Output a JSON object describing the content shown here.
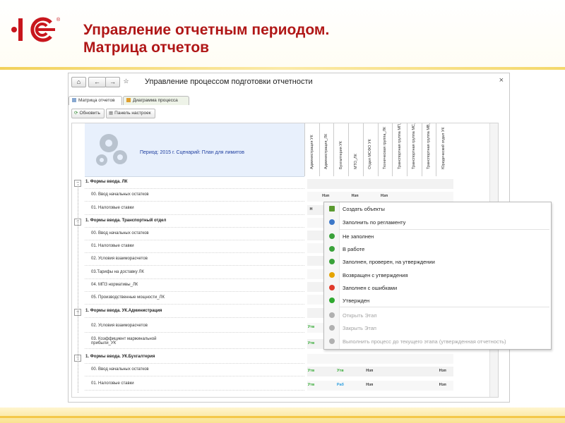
{
  "slide": {
    "title_line1": "Управление отчетным периодом.",
    "title_line2": "Матрица отчетов",
    "logo_text": "1С",
    "brand_color": "#b01717",
    "accent_color": "#f4c84a"
  },
  "window": {
    "title": "Управление процессом подготовки отчетности",
    "home_icon": "home-icon",
    "back_icon": "arrow-left-icon",
    "forward_icon": "arrow-right-icon",
    "close_glyph": "×"
  },
  "tabs": [
    {
      "label": "Матрица отчетов",
      "icon": "grid-icon"
    },
    {
      "label": "Диаграмма процесса",
      "icon": "diagram-icon"
    }
  ],
  "toolbar": {
    "refresh_label": "Обновить",
    "settings_label": "Панель настроек"
  },
  "grid": {
    "period_text": "Период: 2015 г. Сценарий: План для лимитов",
    "columns": [
      "Администрация УК",
      "Администрация_ЛК",
      "Бухгалтерия УК",
      "МТО_ЛК",
      "Отдел МСФО УК",
      "Техническая группа_ЛК",
      "Транспортная группа МП_ЛК",
      "Транспортная группа МС_ЛК",
      "Транспортная группа МВ_ЛК",
      "Юридический отдел УК"
    ],
    "rows": [
      {
        "text": "1. Формы ввода. ЛК",
        "group": true
      },
      {
        "text": "00. Ввод начальных остатков",
        "group": false,
        "cells": [
          "",
          "Нзп",
          "",
          "Нзп",
          "",
          "Нзп",
          "",
          "",
          "",
          ""
        ]
      },
      {
        "text": "01. Налоговые ставки",
        "group": false,
        "cells": [
          "Н",
          "",
          "",
          "",
          "",
          "",
          "",
          "",
          "",
          ""
        ]
      },
      {
        "text": "1. Формы ввода. Транспортный отдел",
        "group": true
      },
      {
        "text": "00. Ввод начальных остатков",
        "group": false
      },
      {
        "text": "01. Налоговые ставки",
        "group": false
      },
      {
        "text": "02. Условия взаиморасчетов",
        "group": false
      },
      {
        "text": "03.Тарифы на доставку ЛК",
        "group": false
      },
      {
        "text": "04. МПЗ нормативы_ЛК",
        "group": false
      },
      {
        "text": "05. Производственные мощности_ЛК",
        "group": false
      },
      {
        "text": "1. Формы ввода. УК.Администрация",
        "group": true
      },
      {
        "text": "02. Условия взаиморасчетов",
        "group": false,
        "cells": [
          "Утв",
          "",
          "",
          "",
          "",
          "",
          "",
          "",
          "",
          ""
        ]
      },
      {
        "text": "03. Коэффициент маржинальной прибыли_УК",
        "group": false,
        "cells": [
          "Утв",
          "",
          "",
          "",
          "",
          "",
          "",
          "",
          "",
          ""
        ]
      },
      {
        "text": "1. Формы ввода. УК.Бухгалтерия",
        "group": true
      },
      {
        "text": "00. Ввод начальных остатков",
        "group": false,
        "cells": [
          "Утв",
          "",
          "Утв",
          "",
          "Нзп",
          "",
          "",
          "",
          "",
          "Нзп"
        ]
      },
      {
        "text": "01. Налоговые ставки",
        "group": false,
        "cells": [
          "Утв",
          "",
          "Раб",
          "",
          "Нзп",
          "",
          "",
          "",
          "",
          "Нзп"
        ]
      }
    ]
  },
  "context_menu": {
    "items": [
      {
        "label": "Создать объекты",
        "icon": "create-objects-icon",
        "color": "#5a9a2f",
        "disabled": false
      },
      {
        "label": "Заполнить по регламенту",
        "icon": "play-circle-icon",
        "color": "#3d78c8",
        "disabled": false
      },
      {
        "label": "Не заполнен",
        "icon": "status-empty-icon",
        "color": "#3aa23a",
        "disabled": false
      },
      {
        "label": "В работе",
        "icon": "status-in-work-icon",
        "color": "#3aa23a",
        "disabled": false
      },
      {
        "label": "Заполнен, проверен, на утверждении",
        "icon": "status-review-icon",
        "color": "#3aa23a",
        "disabled": false
      },
      {
        "label": "Возвращен с утверждения",
        "icon": "status-returned-icon",
        "color": "#e5a400",
        "disabled": false
      },
      {
        "label": "Заполнен с ошибками",
        "icon": "status-error-icon",
        "color": "#e03a2a",
        "disabled": false
      },
      {
        "label": "Утвержден",
        "icon": "status-approved-icon",
        "color": "#2fa82f",
        "disabled": false
      },
      {
        "label": "Открыть Этап",
        "icon": "open-stage-icon",
        "color": "#b0b0b0",
        "disabled": true
      },
      {
        "label": "Закрыть Этап",
        "icon": "close-stage-icon",
        "color": "#b0b0b0",
        "disabled": true
      },
      {
        "label": "Выполнить процесс до текущего этапа (утвержденная отчетность)",
        "icon": "run-process-icon",
        "color": "#b0b0b0",
        "disabled": true
      }
    ]
  }
}
